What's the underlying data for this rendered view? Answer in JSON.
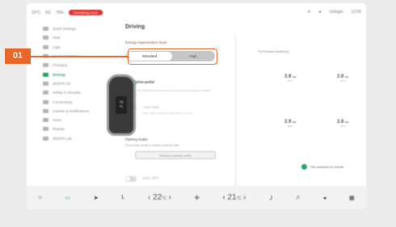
{
  "status": {
    "temp": "20°C",
    "signal": "5G",
    "battery": "76%",
    "alert": "Overtaking mode",
    "user": "Unlogin",
    "time": "12:56"
  },
  "sidebar": [
    {
      "label": "Quick Settings",
      "active": false,
      "icon": "sliders-icon"
    },
    {
      "label": "Seat",
      "active": false,
      "icon": "seat-icon"
    },
    {
      "label": "Light",
      "active": false,
      "icon": "light-icon"
    },
    {
      "label": "Doors & Windows",
      "active": false,
      "icon": "door-icon"
    },
    {
      "label": "Charging",
      "active": false,
      "icon": "charging-icon"
    },
    {
      "label": "Driving",
      "active": true,
      "icon": "car-icon"
    },
    {
      "label": "ZEEKR AD",
      "active": false,
      "icon": "ad-icon"
    },
    {
      "label": "Safety & Security",
      "active": false,
      "icon": "shield-icon"
    },
    {
      "label": "Connectivity",
      "active": false,
      "icon": "wifi-icon"
    },
    {
      "label": "Sounds & Notifications",
      "active": false,
      "icon": "sound-icon"
    },
    {
      "label": "Voice",
      "active": false,
      "icon": "mic-icon"
    },
    {
      "label": "Display",
      "active": false,
      "icon": "display-icon"
    },
    {
      "label": "ZEEKR Lab",
      "active": false,
      "icon": "lab-icon"
    }
  ],
  "main": {
    "title": "Driving",
    "regen_label": "Energy regeneration level",
    "regen_options": [
      "Standard",
      "High"
    ],
    "regen_selected": "Standard",
    "one_pedal": {
      "label": "One-pedal",
      "desc": "The vehicle will decelerate and stop when the accelerator is released",
      "enabled": true
    },
    "auto_hold": {
      "label": "Auto Hold",
      "desc": "Keep vehicle stationary after braking to a stop",
      "enabled": false
    },
    "parking": {
      "label": "Parking brake",
      "desc": "Press brake pedal to release parking brake",
      "button": "Release parking brake"
    },
    "esc": {
      "label": "ESC OFF",
      "enabled": false
    }
  },
  "tire": {
    "title": "Tire Pressure Monitoring",
    "fl": {
      "p": "2.8",
      "u": "bar",
      "t": "20°C"
    },
    "fr": {
      "p": "2.8",
      "u": "bar",
      "t": "19°C"
    },
    "rl": {
      "p": "2.9",
      "u": "bar",
      "t": "18°C"
    },
    "rr": {
      "p": "2.8",
      "u": "bar",
      "t": "19°C"
    },
    "car_screen": "75",
    "car_unit": "%",
    "status": "Tire pressure is normal"
  },
  "dock": {
    "temp_left": "22",
    "temp_right": "21",
    "temp_unit": "°C"
  },
  "callout": {
    "label": "01",
    "color": "#e8662a"
  }
}
